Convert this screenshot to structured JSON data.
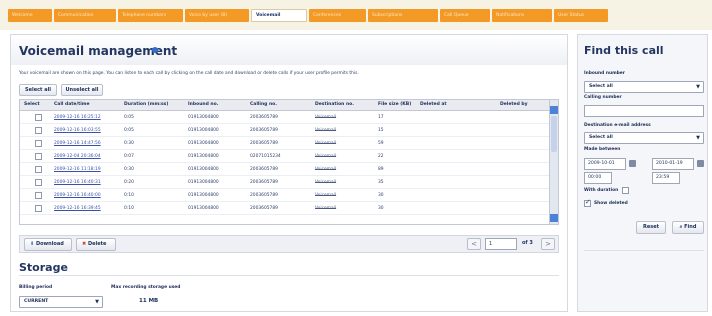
{
  "tabs": [
    {
      "label": "Welcome"
    },
    {
      "label": "Communication"
    },
    {
      "label": "Telephone numbers"
    },
    {
      "label": "Voice by user (B)"
    },
    {
      "label": "Voicemail"
    },
    {
      "label": "Conferences"
    },
    {
      "label": "Subscriptions"
    },
    {
      "label": "Call Queue"
    },
    {
      "label": "Notifications"
    },
    {
      "label": "User Status"
    }
  ],
  "active_tab": "Voicemail",
  "main": {
    "title": "Voicemail management",
    "description": "Your voicemail are shown on this page. You can listen to each call by clicking on the call date and download or delete calls if your user profile permits this.",
    "select_all_label": "Select all",
    "unselect_all_label": "Unselect all",
    "columns": [
      "Select",
      "Call date/time",
      "Duration (mm:ss)",
      "Inbound no.",
      "Calling no.",
      "Destination no.",
      "File size (KB)",
      "Deleted at",
      "Deleted by"
    ],
    "rows": [
      {
        "date": "2009-12-16 16:25:12",
        "duration": "0:05",
        "inbound": "01913004800",
        "calling": "2003605789",
        "destination": "Voicemail",
        "size": "17",
        "selected": false
      },
      {
        "date": "2009-12-16 16:03:55",
        "duration": "0:05",
        "inbound": "01913004800",
        "calling": "2003605789",
        "destination": "Voicemail",
        "size": "15",
        "selected": false
      },
      {
        "date": "2009-12-16 14:47:56",
        "duration": "0:30",
        "inbound": "01913004800",
        "calling": "2003605789",
        "destination": "Voicemail",
        "size": "59",
        "selected": false
      },
      {
        "date": "2009-12-04 20:36:04",
        "duration": "0:07",
        "inbound": "01913004800",
        "calling": "02071015234",
        "destination": "Voicemail",
        "size": "22",
        "selected": false
      },
      {
        "date": "2009-12-16 11:18:19",
        "duration": "0:30",
        "inbound": "01913004800",
        "calling": "2003605789",
        "destination": "Voicemail",
        "size": "89",
        "selected": false
      },
      {
        "date": "2009-12-16 16:40:31",
        "duration": "0:20",
        "inbound": "01913004800",
        "calling": "2003605789",
        "destination": "Voicemail",
        "size": "35",
        "selected": false
      },
      {
        "date": "2009-12-16 16:40:00",
        "duration": "0:10",
        "inbound": "01913004800",
        "calling": "2003605789",
        "destination": "Voicemail",
        "size": "30",
        "selected": false
      },
      {
        "date": "2009-12-16 16:39:45",
        "duration": "0:10",
        "inbound": "01913004800",
        "calling": "2003605789",
        "destination": "Voicemail",
        "size": "30",
        "selected": false
      }
    ],
    "download_label": "Download",
    "delete_label": "Delete",
    "pagination": {
      "prev": "<",
      "next": ">",
      "page": "1",
      "of": "of 3"
    }
  },
  "storage": {
    "title": "Storage",
    "billing_period_label": "Billing period",
    "billing_period_value": "CURRENT",
    "storage_used_label": "Max recording storage used",
    "storage_used_value": "11 MB"
  },
  "sidebar": {
    "title": "Find this call",
    "inbound_label": "Inbound number",
    "inbound_value": "Select all",
    "calling_label": "Calling number",
    "calling_value": "",
    "destination_label": "Destination e-mail address",
    "destination_value": "Select all",
    "made_between_label": "Made between",
    "date_from": "2009-10-01",
    "date_to": "2010-01-19",
    "time_from": "00:00",
    "time_to": "23:59",
    "with_duration_label": "With duration",
    "with_duration_checked": false,
    "show_deleted_label": "Show deleted",
    "show_deleted_checked": true,
    "reset_label": "Reset",
    "find_label": "Find"
  },
  "colors": {
    "tab_orange": "#f29a25",
    "title_navy": "#233561",
    "accent_blue": "#4c83d9"
  }
}
